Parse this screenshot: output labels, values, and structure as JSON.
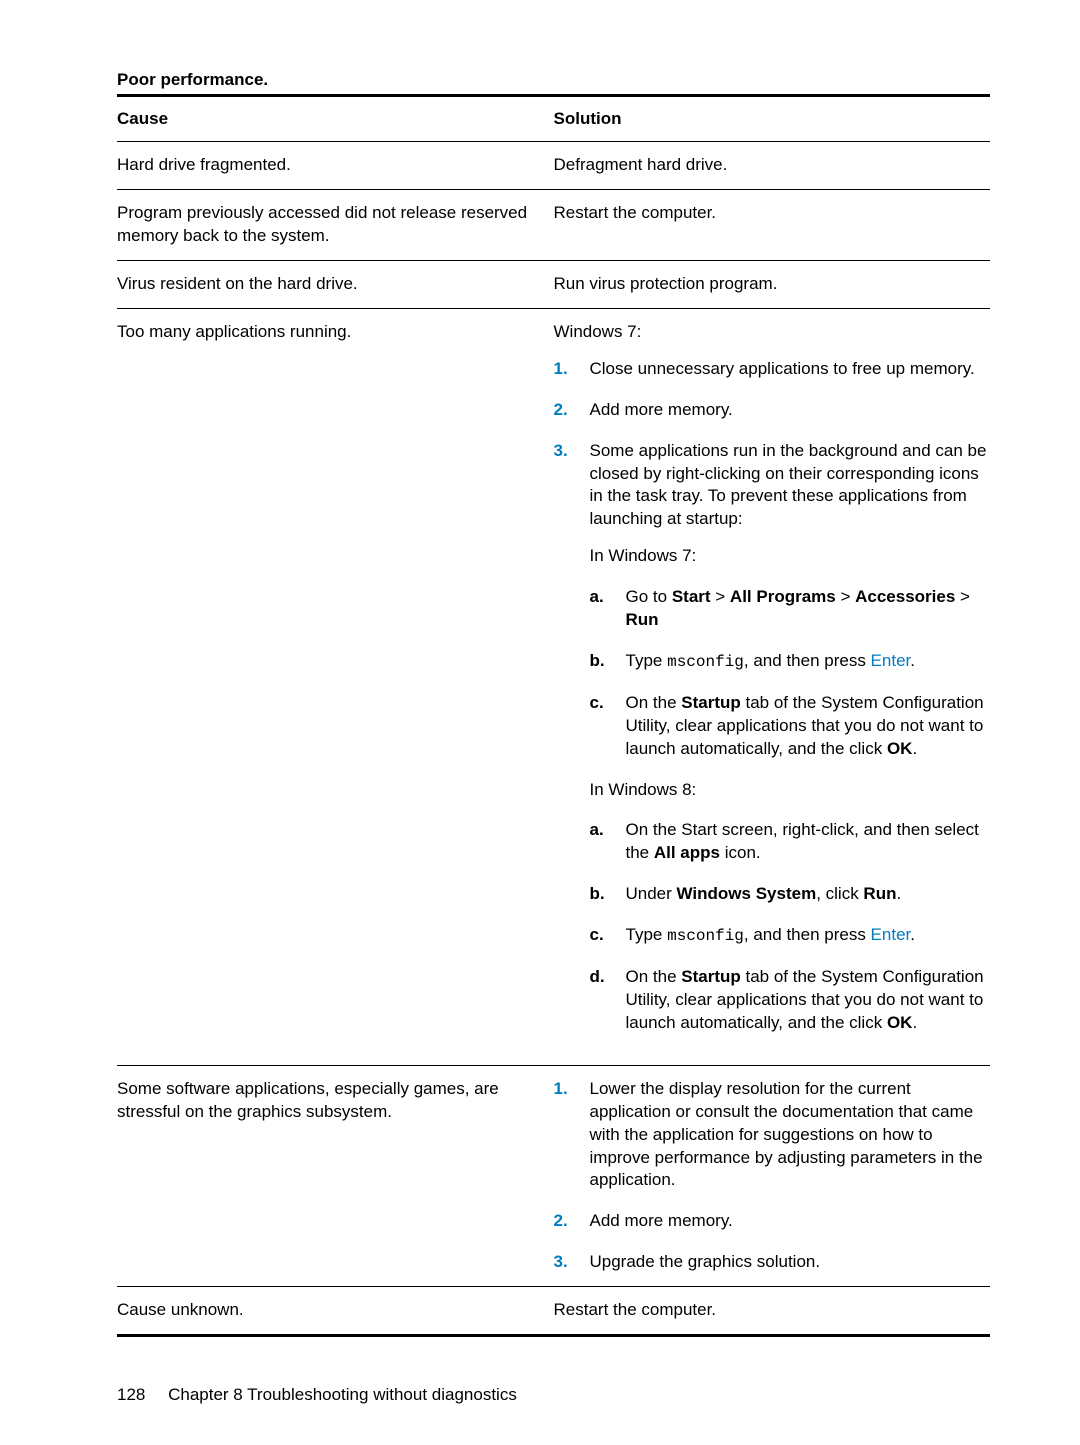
{
  "section_title": "Poor performance.",
  "headers": {
    "cause": "Cause",
    "solution": "Solution"
  },
  "rows": {
    "r1": {
      "cause": "Hard drive fragmented.",
      "solution": "Defragment hard drive."
    },
    "r2": {
      "cause": "Program previously accessed did not release reserved memory back to the system.",
      "solution": "Restart the computer."
    },
    "r3": {
      "cause": "Virus resident on the hard drive.",
      "solution": "Run virus protection program."
    },
    "r4": {
      "cause": "Too many applications running.",
      "solution": {
        "intro": "Windows 7:",
        "step1": "Close unnecessary applications to free up memory.",
        "step2": "Add more memory.",
        "step3": "Some applications run in the background and can be closed by right-clicking on their corresponding icons in the task tray. To prevent these applications from launching at startup:",
        "win7_label": "In Windows 7:",
        "w7": {
          "a_pre": "Go to ",
          "a_b1": "Start",
          "a_sep": " > ",
          "a_b2": "All Programs",
          "a_b3": "Accessories",
          "a_b4": "Run",
          "b_pre": "Type ",
          "b_code": "msconfig",
          "b_mid": ", and then press ",
          "b_key": "Enter",
          "b_post": ".",
          "c_pre": "On the ",
          "c_b1": "Startup",
          "c_mid": " tab of the System Configuration Utility, clear applications that you do not want to launch automatically, and the click ",
          "c_b2": "OK",
          "c_post": "."
        },
        "win8_label": "In Windows 8:",
        "w8": {
          "a_pre": "On the Start screen, right-click, and then select the ",
          "a_b1": "All apps",
          "a_post": " icon.",
          "b_pre": "Under ",
          "b_b1": "Windows System",
          "b_mid": ", click ",
          "b_b2": "Run",
          "b_post": ".",
          "c_pre": "Type ",
          "c_code": "msconfig",
          "c_mid": ", and then press ",
          "c_key": "Enter",
          "c_post": ".",
          "d_pre": "On the ",
          "d_b1": "Startup",
          "d_mid": " tab of the System Configuration Utility, clear applications that you do not want to launch automatically, and the click ",
          "d_b2": "OK",
          "d_post": "."
        }
      }
    },
    "r5": {
      "cause": "Some software applications, especially games, are stressful on the graphics subsystem.",
      "solution": {
        "step1": "Lower the display resolution for the current application or consult the documentation that came with the application for suggestions on how to improve performance by adjusting parameters in the application.",
        "step2": "Add more memory.",
        "step3": "Upgrade the graphics solution."
      }
    },
    "r6": {
      "cause": "Cause unknown.",
      "solution": "Restart the computer."
    }
  },
  "markers": {
    "n1": "1.",
    "n2": "2.",
    "n3": "3.",
    "la": "a.",
    "lb": "b.",
    "lc": "c.",
    "ld": "d."
  },
  "footer": {
    "page": "128",
    "chapter": "Chapter 8   Troubleshooting without diagnostics"
  }
}
